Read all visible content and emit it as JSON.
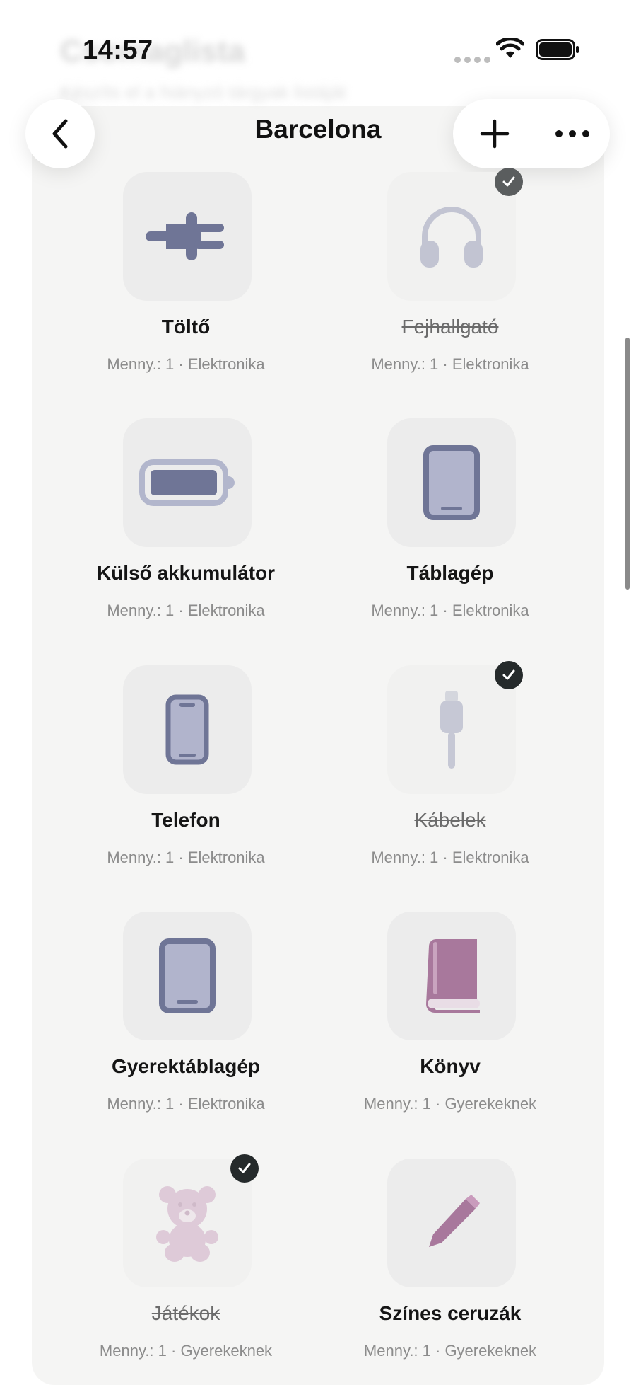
{
  "status": {
    "time": "14:57"
  },
  "header_ghost": {
    "title": "Csomaglista",
    "subtitle": "Készíts el a hiányzó tárgyak listáját"
  },
  "nav": {
    "title": "Barcelona"
  },
  "items": [
    {
      "name": "Töltő",
      "meta": "Menny.: 1 · Elektronika",
      "icon": "plug-icon",
      "checked": false
    },
    {
      "name": "Fejhallgató",
      "meta": "Menny.: 1 · Elektronika",
      "icon": "headphones-icon",
      "checked": true
    },
    {
      "name": "Külső akkumulátor",
      "meta": "Menny.: 1 · Elektronika",
      "icon": "battery-icon",
      "checked": false
    },
    {
      "name": "Táblagép",
      "meta": "Menny.: 1 · Elektronika",
      "icon": "tablet-icon",
      "checked": false
    },
    {
      "name": "Telefon",
      "meta": "Menny.: 1 · Elektronika",
      "icon": "phone-icon",
      "checked": false
    },
    {
      "name": "Kábelek",
      "meta": "Menny.: 1 · Elektronika",
      "icon": "cable-icon",
      "checked": true
    },
    {
      "name": "Gyerektáblagép",
      "meta": "Menny.: 1 · Elektronika",
      "icon": "tablet-icon",
      "checked": false
    },
    {
      "name": "Könyv",
      "meta": "Menny.: 1 · Gyerekeknek",
      "icon": "book-icon",
      "checked": false
    },
    {
      "name": "Játékok",
      "meta": "Menny.: 1 · Gyerekeknek",
      "icon": "teddy-bear-icon",
      "checked": true
    },
    {
      "name": "Színes ceruzák",
      "meta": "Menny.: 1 · Gyerekeknek",
      "icon": "pencil-icon",
      "checked": false
    }
  ],
  "colors": {
    "electronics_icon": "#6f7596",
    "kids_icon": "#a8789c",
    "check_badge": "#252a2b",
    "card_background": "#f5f5f4"
  }
}
